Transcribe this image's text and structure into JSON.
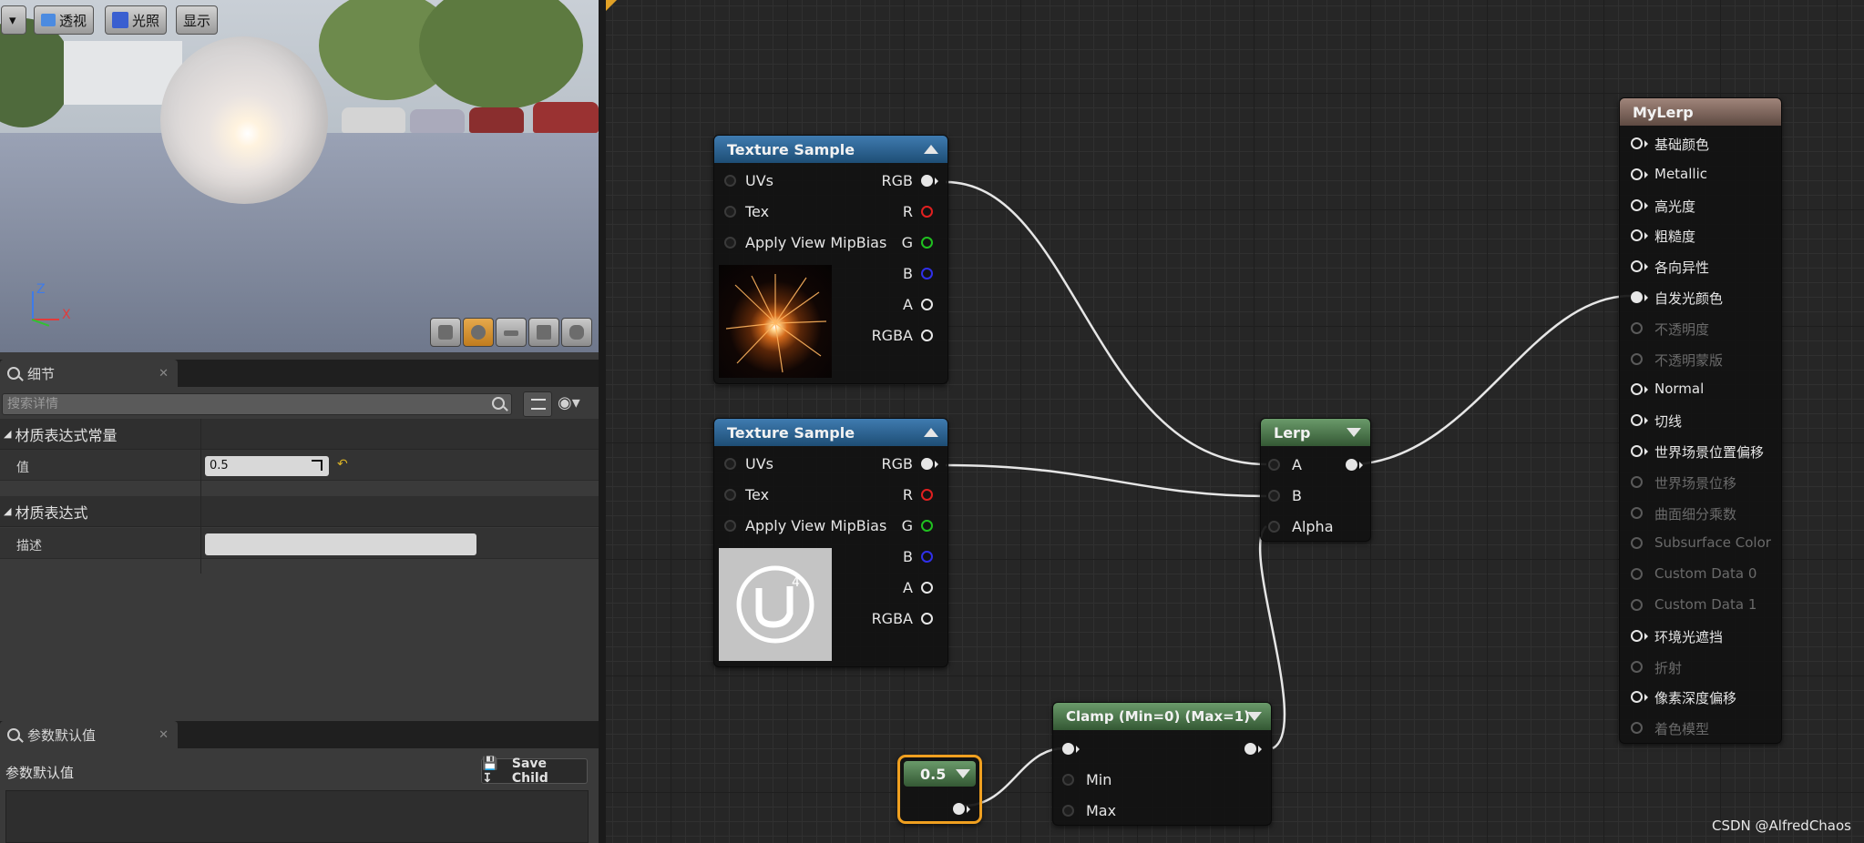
{
  "viewport": {
    "buttons": {
      "menu": "▾",
      "perspective": "透视",
      "lighting": "光照",
      "show": "显示"
    },
    "axis_z": "Z",
    "axis_x": "X",
    "preview_mesh_icons": [
      "cylinder-icon",
      "sphere-icon",
      "plane-icon",
      "cube-icon",
      "custom-mesh-icon"
    ]
  },
  "details_panel": {
    "tab_label": "细节",
    "search_placeholder": "搜索详情",
    "section1_title": "材质表达式常量",
    "value_label": "值",
    "value": "0.5",
    "section2_title": "材质表达式",
    "desc_label": "描述"
  },
  "params_panel": {
    "tab_label": "参数默认值",
    "label": "参数默认值",
    "save_child": "Save Child"
  },
  "graph": {
    "texture_sample_1": {
      "title": "Texture Sample",
      "inputs": [
        "UVs",
        "Tex",
        "Apply View MipBias"
      ],
      "outputs": [
        "RGB",
        "R",
        "G",
        "B",
        "A",
        "RGBA"
      ]
    },
    "texture_sample_2": {
      "title": "Texture Sample",
      "inputs": [
        "UVs",
        "Tex",
        "Apply View MipBias"
      ],
      "outputs": [
        "RGB",
        "R",
        "G",
        "B",
        "A",
        "RGBA"
      ]
    },
    "lerp": {
      "title": "Lerp",
      "inputs": [
        "A",
        "B",
        "Alpha"
      ]
    },
    "clamp": {
      "title": "Clamp (Min=0) (Max=1)",
      "inputs": [
        "Min",
        "Max"
      ]
    },
    "constant": {
      "title": "0.5"
    },
    "mylerp": {
      "title": "MyLerp",
      "pins": [
        "基础颜色",
        "Metallic",
        "高光度",
        "粗糙度",
        "各向异性",
        "自发光颜色",
        "不透明度",
        "不透明蒙版",
        "Normal",
        "切线",
        "世界场景位置偏移",
        "世界场景位移",
        "曲面细分乘数",
        "Subsurface Color",
        "Custom Data 0",
        "Custom Data 1",
        "环境光遮挡",
        "折射",
        "像素深度偏移",
        "着色模型"
      ],
      "active": [
        true,
        true,
        true,
        true,
        true,
        true,
        false,
        false,
        true,
        true,
        true,
        false,
        false,
        false,
        false,
        false,
        true,
        false,
        true,
        false
      ]
    },
    "pin_colors": {
      "R": "#e02020",
      "G": "#20c020",
      "B": "#3030e8",
      "A": "#e6e6e6",
      "RGB": "#ffffff",
      "RGBA": "#e6e6e6"
    }
  },
  "watermark": "CSDN @AlfredChaos"
}
